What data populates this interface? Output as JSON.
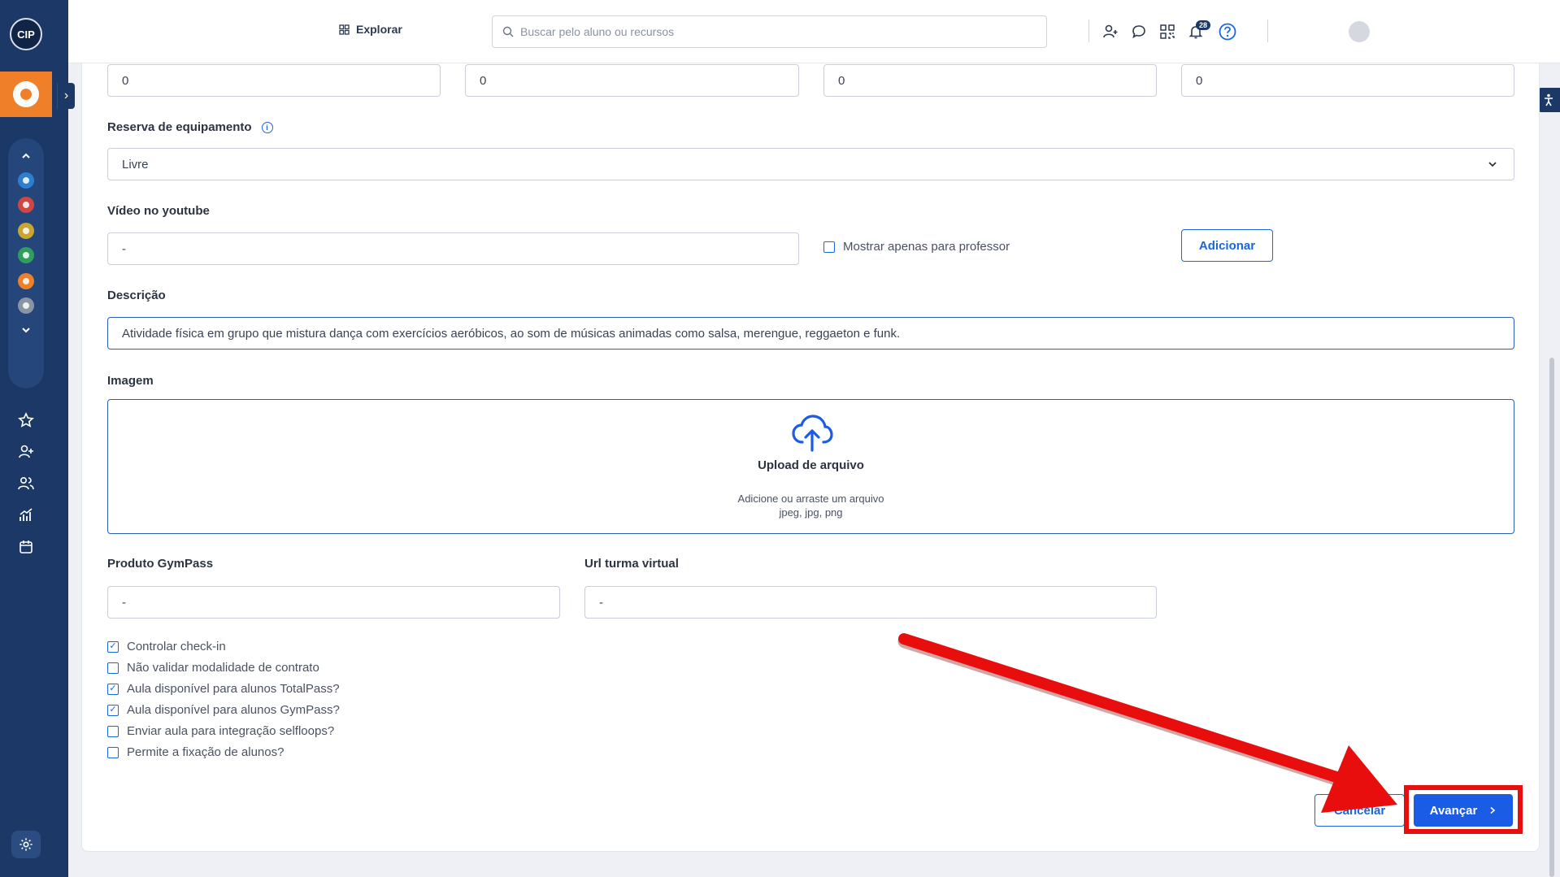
{
  "header": {
    "explore_label": "Explorar",
    "search_placeholder": "Buscar pelo aluno ou recursos",
    "notification_count": "28"
  },
  "rail": {
    "logo_text": "CIP",
    "expand_glyph": "›",
    "module_colors": [
      "#2f7fd0",
      "#d04545",
      "#c9a531",
      "#2f9e5d",
      "#f07f2a",
      "#8a94a3"
    ]
  },
  "form": {
    "numbers": [
      "0",
      "0",
      "0",
      "0"
    ],
    "equipment": {
      "label": "Reserva de equipamento",
      "value": "Livre"
    },
    "youtube": {
      "label": "Vídeo no youtube",
      "value": "-",
      "teacher_only_label": "Mostrar apenas para professor",
      "add_button": "Adicionar"
    },
    "description": {
      "label": "Descrição",
      "value": "Atividade física em grupo que mistura dança com exercícios aeróbicos, ao som de músicas animadas como salsa, merengue, reggaeton e funk."
    },
    "image": {
      "label": "Imagem",
      "upload_title": "Upload de arquivo",
      "upload_hint": "Adicione ou arraste um arquivo",
      "upload_formats": "jpeg, jpg, png"
    },
    "gympass": {
      "label": "Produto GymPass",
      "value": "-"
    },
    "virtual_url": {
      "label": "Url turma virtual",
      "value": "-"
    },
    "options": [
      {
        "label": "Controlar check-in",
        "checked": true
      },
      {
        "label": "Não validar modalidade de contrato",
        "checked": false
      },
      {
        "label": "Aula disponível para alunos TotalPass?",
        "checked": true
      },
      {
        "label": "Aula disponível para alunos GymPass?",
        "checked": true
      },
      {
        "label": "Enviar aula para integração selfloops?",
        "checked": false
      },
      {
        "label": "Permite a fixação de alunos?",
        "checked": false
      }
    ],
    "cancel_button": "Cancelar",
    "next_button": "Avançar"
  },
  "annotation_color": "#e80e0e"
}
